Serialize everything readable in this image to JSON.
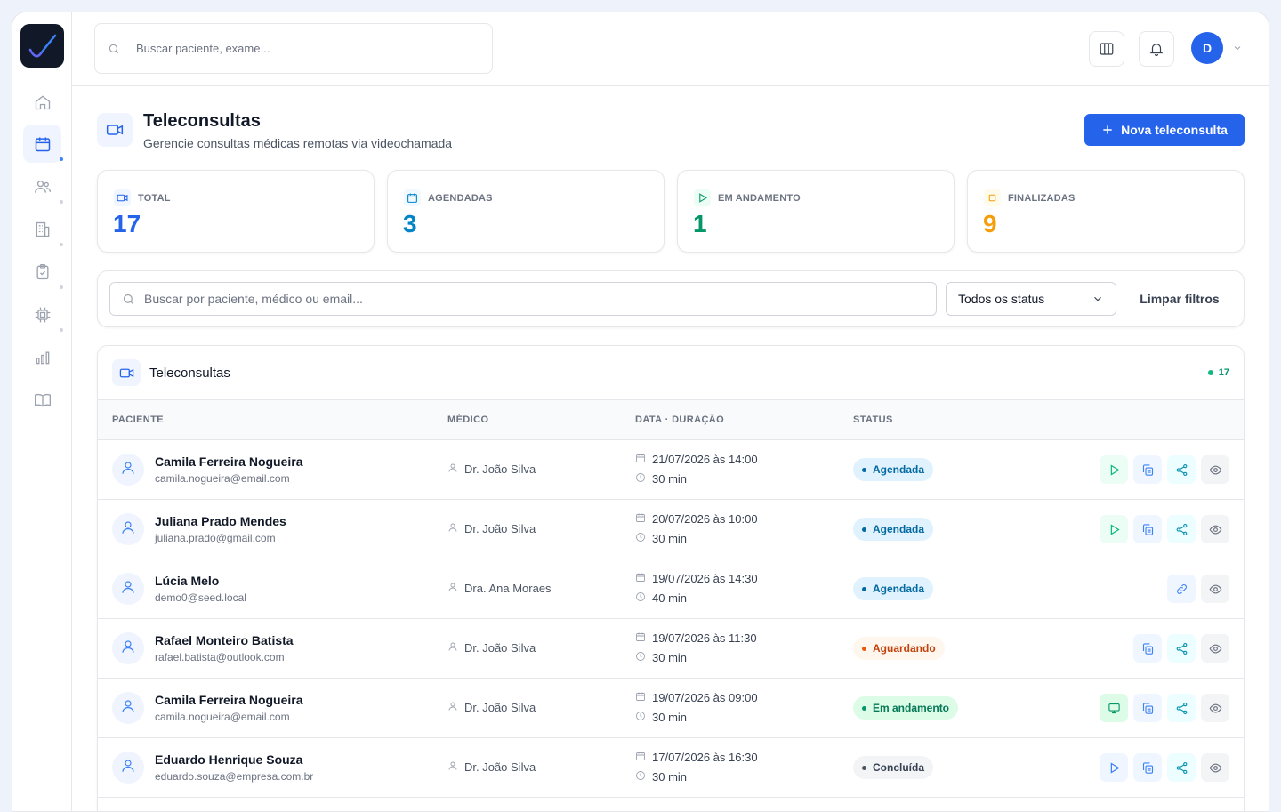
{
  "colors": {
    "primary": "#2563eb",
    "total": "#2563eb",
    "agendadas": "#0284c7",
    "em_andamento": "#059669",
    "finalizadas": "#f59e0b"
  },
  "sidebar": {
    "items": [
      {
        "icon": "home-icon"
      },
      {
        "icon": "calendar-icon",
        "active": true
      },
      {
        "icon": "users-icon"
      },
      {
        "icon": "building-icon"
      },
      {
        "icon": "clipboard-check-icon"
      },
      {
        "icon": "chip-icon"
      },
      {
        "icon": "bar-chart-icon"
      },
      {
        "icon": "book-icon"
      }
    ]
  },
  "topbar": {
    "search_placeholder": "Buscar paciente, exame...",
    "avatar_initial": "D"
  },
  "header": {
    "title": "Teleconsultas",
    "subtitle": "Gerencie consultas médicas remotas via videochamada",
    "new_button": "Nova teleconsulta"
  },
  "stats": [
    {
      "label": "TOTAL",
      "value": "17",
      "icon": "video-icon"
    },
    {
      "label": "AGENDADAS",
      "value": "3",
      "icon": "calendar-icon"
    },
    {
      "label": "EM ANDAMENTO",
      "value": "1",
      "icon": "play-icon"
    },
    {
      "label": "FINALIZADAS",
      "value": "9",
      "icon": "square-icon"
    }
  ],
  "filters": {
    "search_placeholder": "Buscar por paciente, médico ou email...",
    "status_selected": "Todos os status",
    "clear_label": "Limpar filtros"
  },
  "table": {
    "title": "Teleconsultas",
    "count": "17",
    "columns": [
      "PACIENTE",
      "MÉDICO",
      "DATA · DURAÇÃO",
      "STATUS"
    ],
    "rows": [
      {
        "name": "Camila Ferreira Nogueira",
        "email": "camila.nogueira@email.com",
        "doctor": "Dr. João Silva",
        "date": "21/07/2026 às 14:00",
        "duration": "30 min",
        "status": "Agendada",
        "actions": [
          "play",
          "copy",
          "share",
          "eye"
        ]
      },
      {
        "name": "Juliana Prado Mendes",
        "email": "juliana.prado@gmail.com",
        "doctor": "Dr. João Silva",
        "date": "20/07/2026 às 10:00",
        "duration": "30 min",
        "status": "Agendada",
        "actions": [
          "play",
          "copy",
          "share",
          "eye"
        ]
      },
      {
        "name": "Lúcia Melo",
        "email": "demo0@seed.local",
        "doctor": "Dra. Ana Moraes",
        "date": "19/07/2026 às 14:30",
        "duration": "40 min",
        "status": "Agendada",
        "actions": [
          "link",
          "eye"
        ]
      },
      {
        "name": "Rafael Monteiro Batista",
        "email": "rafael.batista@outlook.com",
        "doctor": "Dr. João Silva",
        "date": "19/07/2026 às 11:30",
        "duration": "30 min",
        "status": "Aguardando",
        "actions": [
          "copy",
          "share",
          "eye"
        ]
      },
      {
        "name": "Camila Ferreira Nogueira",
        "email": "camila.nogueira@email.com",
        "doctor": "Dr. João Silva",
        "date": "19/07/2026 às 09:00",
        "duration": "30 min",
        "status": "Em andamento",
        "actions": [
          "screen",
          "copy",
          "share",
          "eye"
        ]
      },
      {
        "name": "Eduardo Henrique Souza",
        "email": "eduardo.souza@empresa.com.br",
        "doctor": "Dr. João Silva",
        "date": "17/07/2026 às 16:30",
        "duration": "30 min",
        "status": "Concluída",
        "actions": [
          "play-blue",
          "copy",
          "share",
          "eye"
        ]
      }
    ]
  }
}
